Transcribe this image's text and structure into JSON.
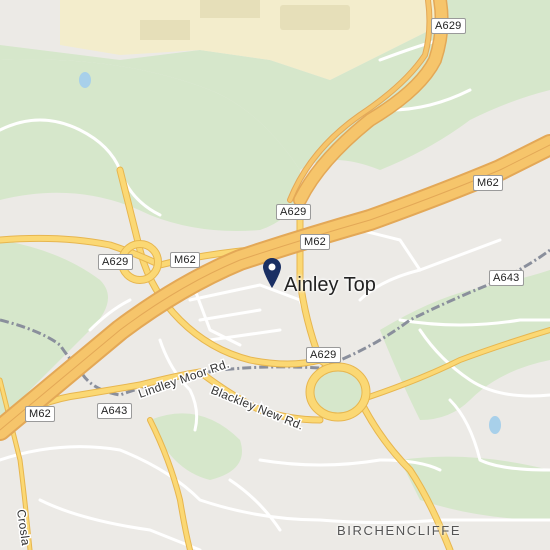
{
  "map": {
    "place_label": "Ainley Top",
    "district_label": "BIRCHENCLIFFE",
    "street_labels": {
      "lindley_moor": "Lindley Moor Rd.",
      "blackley_new": "Blackley New Rd.",
      "crosland": "Crosla"
    },
    "road_shields": {
      "a629_top": "A629",
      "m62_east": "M62",
      "a629_mid": "A629",
      "m62_center": "M62",
      "a629_west": "A629",
      "m62_west": "M62",
      "a643_east": "A643",
      "a629_south": "A629",
      "m62_southwest": "M62",
      "a643_southwest": "A643"
    },
    "marker_icon": "map-pin-icon",
    "colors": {
      "background": "#eceae6",
      "green_area": "#d6e7cb",
      "industrial_area": "#f3edcc",
      "water": "#a8d0ea",
      "motorway_fill": "#f6c56b",
      "motorway_casing": "#e3a857",
      "major_road": "#fbd874",
      "minor_road": "#ffffff",
      "boundary": "#8a8f9c",
      "marker": "#1a2f63"
    }
  }
}
